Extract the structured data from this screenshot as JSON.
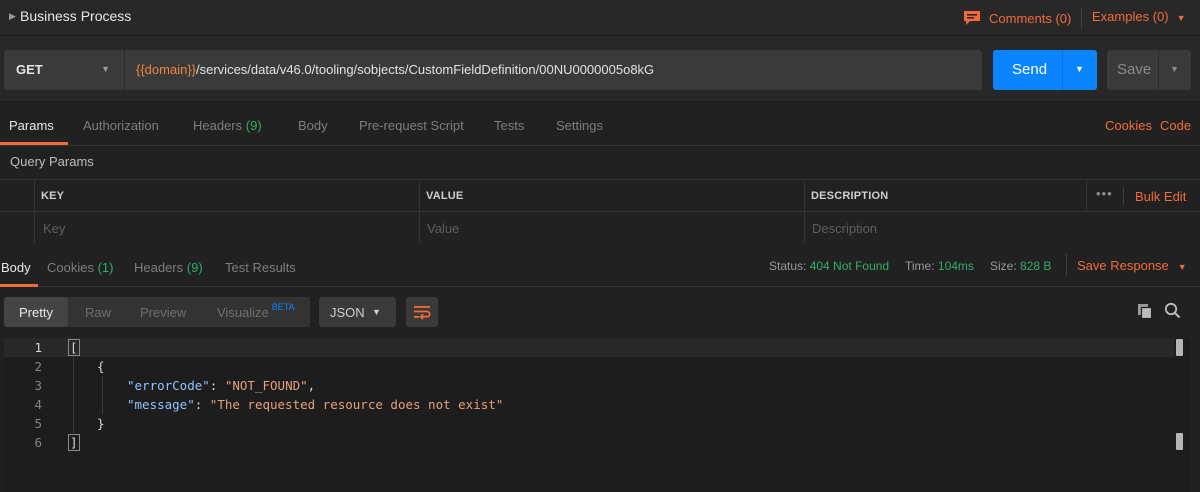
{
  "titlebar": {
    "title": "Business Process",
    "comments_label": "Comments (0)",
    "examples_label": "Examples (0)"
  },
  "request": {
    "method": "GET",
    "url_variable": "{{domain}}",
    "url_path": "/services/data/v46.0/tooling/sobjects/CustomFieldDefinition/00NU0000005o8kG",
    "send_label": "Send",
    "save_label": "Save"
  },
  "request_tabs": [
    {
      "label": "Params",
      "count": ""
    },
    {
      "label": "Authorization",
      "count": ""
    },
    {
      "label": "Headers",
      "count": "(9)"
    },
    {
      "label": "Body",
      "count": ""
    },
    {
      "label": "Pre-request Script",
      "count": ""
    },
    {
      "label": "Tests",
      "count": ""
    },
    {
      "label": "Settings",
      "count": ""
    }
  ],
  "request_links": {
    "cookies": "Cookies",
    "code": "Code"
  },
  "query_params": {
    "title": "Query Params",
    "columns": [
      "KEY",
      "VALUE",
      "DESCRIPTION"
    ],
    "placeholders": [
      "Key",
      "Value",
      "Description"
    ],
    "more_label": "•••",
    "bulk_edit_label": "Bulk Edit"
  },
  "response_tabs": [
    {
      "label": "Body",
      "count": ""
    },
    {
      "label": "Cookies",
      "count": "(1)"
    },
    {
      "label": "Headers",
      "count": "(9)"
    },
    {
      "label": "Test Results",
      "count": ""
    }
  ],
  "response_meta": {
    "status_label": "Status:",
    "status_value": "404 Not Found",
    "time_label": "Time:",
    "time_value": "104ms",
    "size_label": "Size:",
    "size_value": "828 B",
    "save_response_label": "Save Response"
  },
  "view_options": {
    "modes": [
      "Pretty",
      "Raw",
      "Preview",
      "Visualize"
    ],
    "beta_label": "BETA",
    "format": "JSON"
  },
  "response_body": {
    "line_numbers": [
      "1",
      "2",
      "3",
      "4",
      "5",
      "6"
    ],
    "open_bracket": "[",
    "open_brace": "{",
    "key1": "\"errorCode\"",
    "val1": "\"NOT_FOUND\"",
    "key2": "\"message\"",
    "val2": "\"The requested resource does not exist\"",
    "close_brace": "}",
    "close_bracket": "]"
  },
  "colors": {
    "accent": "#f26b3a",
    "send": "#0a84ff",
    "status_ok_text": "#2fae6b",
    "json_key": "#8fc3ff",
    "json_string": "#e5a07b"
  },
  "icons": [
    "caret-right-icon",
    "comment-icon",
    "chevron-down-icon",
    "wrap-lines-icon",
    "copy-icon",
    "search-icon"
  ]
}
